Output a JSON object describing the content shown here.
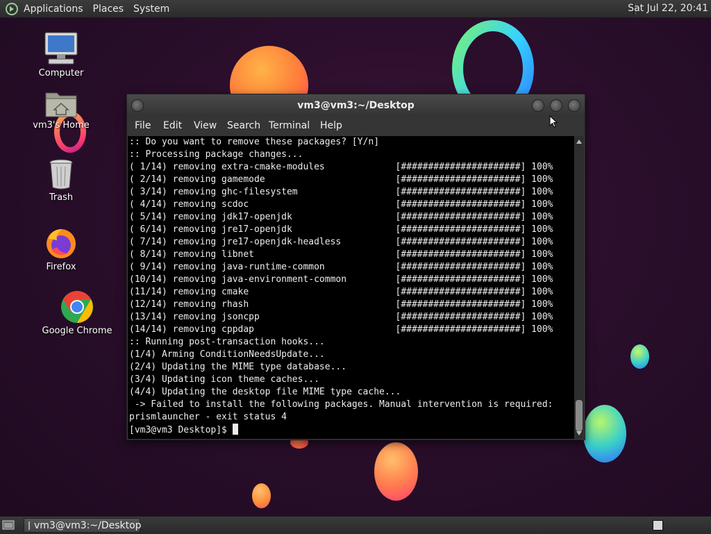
{
  "top_panel": {
    "menus": [
      "Applications",
      "Places",
      "System"
    ],
    "clock": "Sat Jul 22, 20:41"
  },
  "desktop_icons": [
    {
      "label": "Computer",
      "icon": "computer-icon"
    },
    {
      "label": "vm3's Home",
      "icon": "home-folder-icon"
    },
    {
      "label": "Trash",
      "icon": "trash-icon"
    },
    {
      "label": "Firefox",
      "icon": "firefox-icon"
    },
    {
      "label": "Google Chrome",
      "icon": "chrome-icon"
    }
  ],
  "terminal": {
    "title": "vm3@vm3:~/Desktop",
    "menu": [
      "File",
      "Edit",
      "View",
      "Search",
      "Terminal",
      "Help"
    ],
    "lines": [
      ":: Do you want to remove these packages? [Y/n]",
      ":: Processing package changes...",
      "( 1/14) removing extra-cmake-modules             [######################] 100%",
      "( 2/14) removing gamemode                        [######################] 100%",
      "( 3/14) removing ghc-filesystem                  [######################] 100%",
      "( 4/14) removing scdoc                           [######################] 100%",
      "( 5/14) removing jdk17-openjdk                   [######################] 100%",
      "( 6/14) removing jre17-openjdk                   [######################] 100%",
      "( 7/14) removing jre17-openjdk-headless          [######################] 100%",
      "( 8/14) removing libnet                          [######################] 100%",
      "( 9/14) removing java-runtime-common             [######################] 100%",
      "(10/14) removing java-environment-common         [######################] 100%",
      "(11/14) removing cmake                           [######################] 100%",
      "(12/14) removing rhash                           [######################] 100%",
      "(13/14) removing jsoncpp                         [######################] 100%",
      "(14/14) removing cppdap                          [######################] 100%",
      ":: Running post-transaction hooks...",
      "(1/4) Arming ConditionNeedsUpdate...",
      "(2/4) Updating the MIME type database...",
      "(3/4) Updating icon theme caches...",
      "(4/4) Updating the desktop file MIME type cache...",
      " -> Failed to install the following packages. Manual intervention is required:",
      "prismlauncher - exit status 4"
    ],
    "prompt": "[vm3@vm3 Desktop]$ "
  },
  "taskbar": {
    "task_label": "vm3@vm3:~/Desktop"
  },
  "colors": {
    "wallpaper": "#2a0e2b",
    "terminal_bg": "#000000",
    "terminal_fg": "#ececec"
  }
}
